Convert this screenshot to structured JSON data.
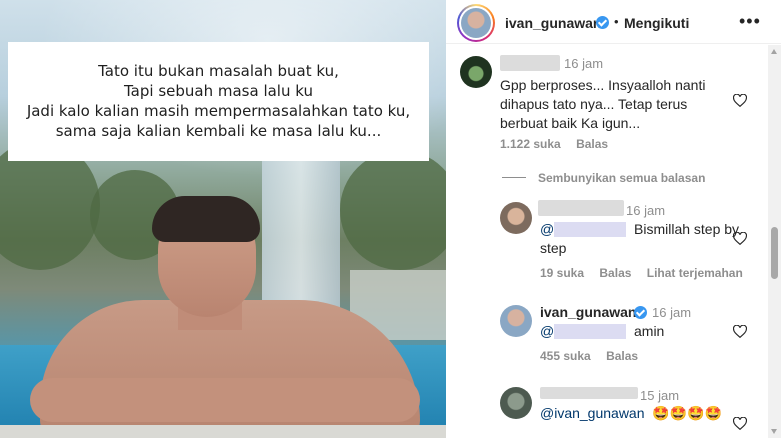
{
  "post": {
    "caption_lines": [
      "Tato itu bukan masalah buat ku,",
      "Tapi sebuah masa lalu ku",
      "Jadi kalo kalian masih mempermasalahkan tato ku,",
      "sama saja kalian kembali ke masa lalu ku..."
    ]
  },
  "header": {
    "username": "ivan_gunawan",
    "separator": "•",
    "follow_status": "Mengikuti",
    "more": "•••"
  },
  "comments": [
    {
      "time": "16 jam",
      "lines": [
        "Gpp berproses... Insyaalloh nanti",
        "dihapus tato nya... Tetap terus",
        "berbuat baik Ka igun..."
      ],
      "likes": "1.122 suka",
      "reply": "Balas"
    }
  ],
  "replies_toggle": "Sembunyikan semua balasan",
  "replies": [
    {
      "time": "16 jam",
      "mention_prefix": "@",
      "text_after": "Bismillah step by",
      "text_line2": "step",
      "likes": "19 suka",
      "reply": "Balas",
      "translate": "Lihat terjemahan"
    },
    {
      "username": "ivan_gunawan",
      "time": "16 jam",
      "mention_prefix": "@",
      "text_after": "amin",
      "likes": "455 suka",
      "reply": "Balas"
    },
    {
      "time": "15 jam",
      "mention": "@ivan_gunawan",
      "emojis": "🤩🤩🤩🤩"
    }
  ],
  "colors": {
    "link": "#00376b",
    "muted": "#8e8e8e",
    "verified": "#3897f0"
  }
}
